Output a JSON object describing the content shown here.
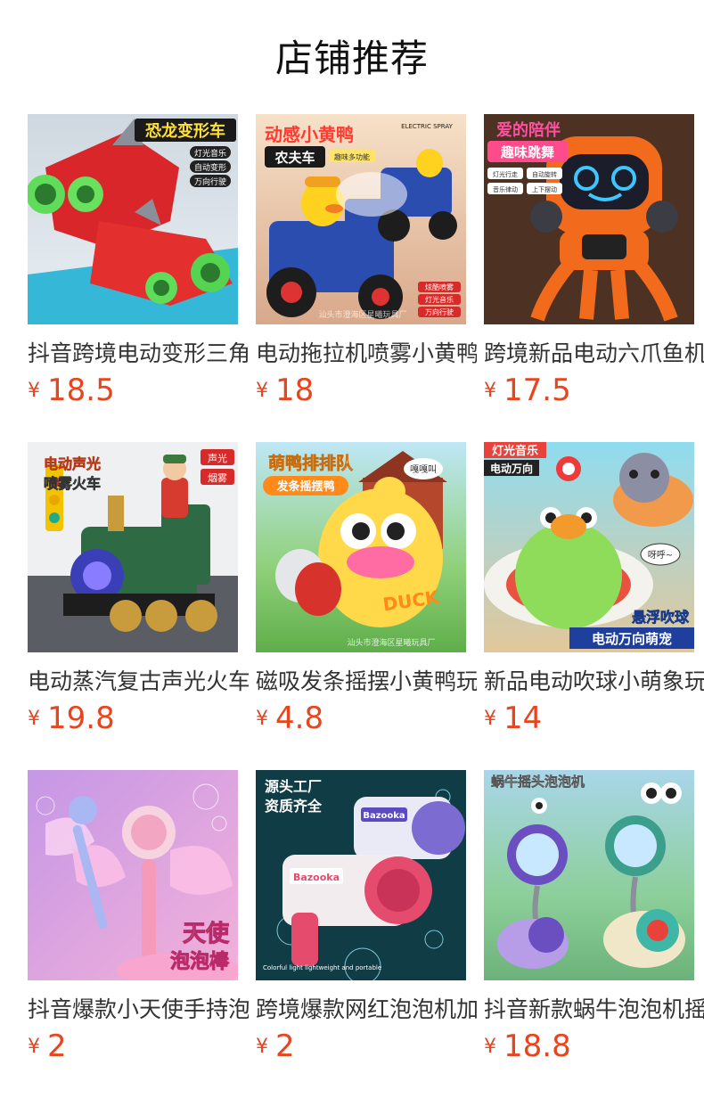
{
  "section": {
    "title": "店铺推荐"
  },
  "currency_symbol": "¥",
  "products": [
    {
      "name": "抖音跨境电动变形三角龙",
      "price": "18.5",
      "image": {
        "label": "恐龙变形车",
        "tags": [
          "灯光音乐",
          "自动变形",
          "万向行驶"
        ]
      }
    },
    {
      "name": "电动拖拉机喷雾小黄鸭农夫车",
      "price": "18",
      "image": {
        "label": "动感小黄鸭",
        "sublabel": "农夫车",
        "corner": "ELECTRIC SPRAY",
        "tag": "趣味多功能",
        "tags": [
          "炫酷喷雾",
          "灯光音乐",
          "万向行驶"
        ],
        "watermark": "汕头市澄海区星曦玩具厂"
      }
    },
    {
      "name": "跨境新品电动六爪鱼机器人",
      "price": "17.5",
      "image": {
        "label": "爱的陪伴",
        "sublabel": "趣味跳舞",
        "tags": [
          "灯光行走",
          "自动旋转",
          "音乐律动",
          "上下摆动"
        ]
      }
    },
    {
      "name": "电动蒸汽复古声光火车",
      "price": "19.8",
      "image": {
        "label": "电动声光",
        "sublabel": "喷雾火车",
        "tags": [
          "声光",
          "烟雾"
        ]
      }
    },
    {
      "name": "磁吸发条摇摆小黄鸭玩具",
      "price": "4.8",
      "image": {
        "label": "萌鸭排排队",
        "sublabel": "发条摇摆鸭",
        "bubble": "嘎嘎叫",
        "brand": "DUCK",
        "watermark": "汕头市澄海区星曦玩具厂"
      }
    },
    {
      "name": "新品电动吹球小萌象玩具",
      "price": "14",
      "image": {
        "label": "灯光音乐",
        "sublabel": "电动万向",
        "bubble": "呀呼~",
        "tags": [
          "悬浮吹球",
          "电动万向萌宠"
        ]
      }
    },
    {
      "name": "抖音爆款小天使手持泡泡棒",
      "price": "2",
      "image": {
        "label": "天使",
        "sublabel": "泡泡棒"
      }
    },
    {
      "name": "跨境爆款网红泡泡机加特林",
      "price": "2",
      "image": {
        "label": "源头工厂",
        "sublabel": "资质齐全",
        "brand": "Bazooka",
        "caption": "Colorful light lightweight and portable"
      }
    },
    {
      "name": "抖音新款蜗牛泡泡机摇头",
      "price": "18.8",
      "image": {
        "label": "蜗牛摇头泡泡机"
      }
    }
  ]
}
